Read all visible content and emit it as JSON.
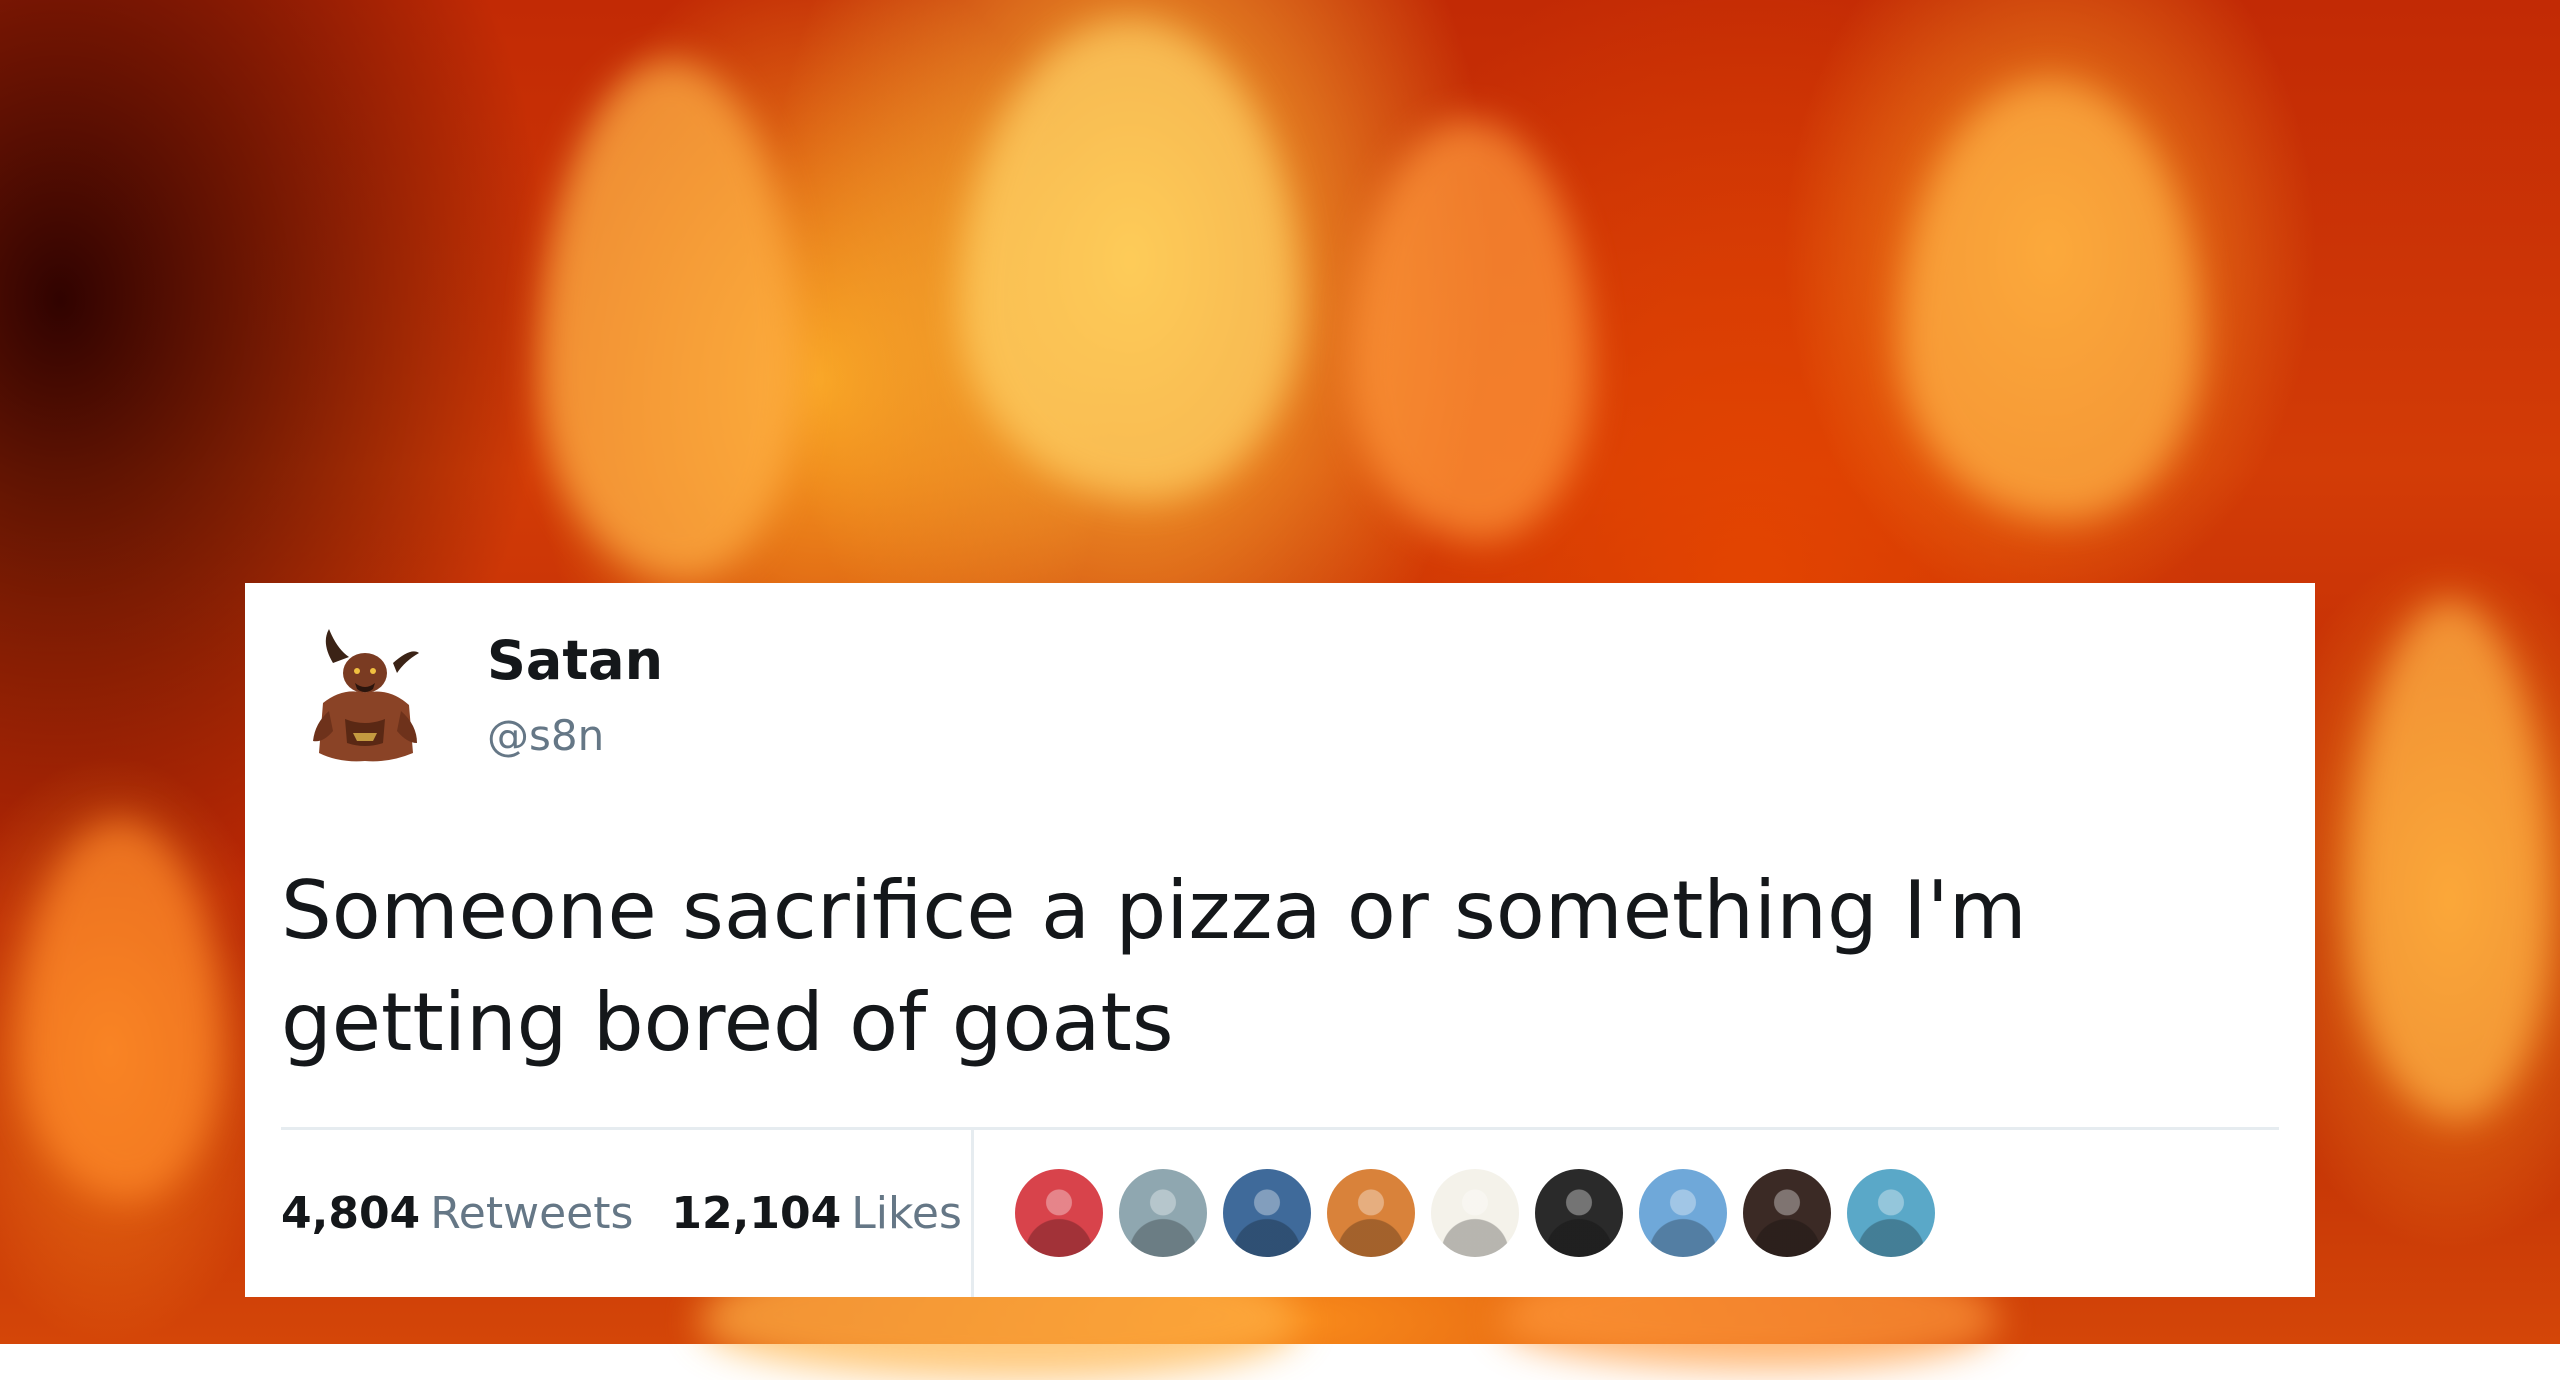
{
  "tweet": {
    "author_name": "Satan",
    "author_handle": "@s8n",
    "text": "Someone sacrifice a pizza or something I'm getting bored of goats",
    "retweets": {
      "count": "4,804",
      "label": "Retweets"
    },
    "likes": {
      "count": "12,104",
      "label": "Likes"
    },
    "liker_avatars": [
      {
        "name": "liker-avatar-1",
        "color": "#d8434b"
      },
      {
        "name": "liker-avatar-2",
        "color": "#8fa7b0"
      },
      {
        "name": "liker-avatar-3",
        "color": "#3f6a9a"
      },
      {
        "name": "liker-avatar-4",
        "color": "#d9823a"
      },
      {
        "name": "liker-avatar-5",
        "color": "#f4f2ea"
      },
      {
        "name": "liker-avatar-6",
        "color": "#2a2a2a"
      },
      {
        "name": "liker-avatar-7",
        "color": "#6fa8d9"
      },
      {
        "name": "liker-avatar-8",
        "color": "#3b2a25"
      },
      {
        "name": "liker-avatar-9",
        "color": "#5aa8c8"
      }
    ]
  },
  "colors": {
    "card_background": "#ffffff",
    "text_primary": "#14171a",
    "text_secondary": "#657786",
    "divider": "#e6ecf0"
  }
}
